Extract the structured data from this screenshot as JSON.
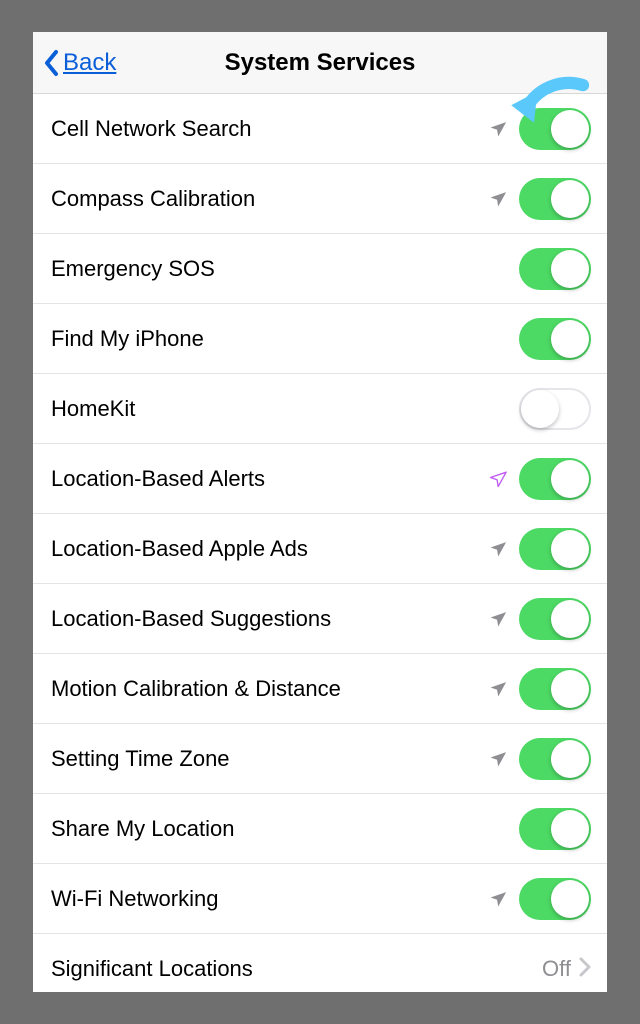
{
  "nav": {
    "back": "Back",
    "title": "System Services"
  },
  "colors": {
    "tint": "#007aff",
    "toggle_on": "#4cd964",
    "arrow_gray": "#8e8e93",
    "arrow_purple": "#bf5af2",
    "annotation": "#5ac8fa"
  },
  "rows": [
    {
      "label": "Cell Network Search",
      "accessory": "toggle",
      "on": true,
      "arrow": "gray"
    },
    {
      "label": "Compass Calibration",
      "accessory": "toggle",
      "on": true,
      "arrow": "gray"
    },
    {
      "label": "Emergency SOS",
      "accessory": "toggle",
      "on": true,
      "arrow": null
    },
    {
      "label": "Find My iPhone",
      "accessory": "toggle",
      "on": true,
      "arrow": null
    },
    {
      "label": "HomeKit",
      "accessory": "toggle",
      "on": false,
      "arrow": null
    },
    {
      "label": "Location-Based Alerts",
      "accessory": "toggle",
      "on": true,
      "arrow": "purple"
    },
    {
      "label": "Location-Based Apple Ads",
      "accessory": "toggle",
      "on": true,
      "arrow": "gray"
    },
    {
      "label": "Location-Based Suggestions",
      "accessory": "toggle",
      "on": true,
      "arrow": "gray"
    },
    {
      "label": "Motion Calibration & Distance",
      "accessory": "toggle",
      "on": true,
      "arrow": "gray"
    },
    {
      "label": "Setting Time Zone",
      "accessory": "toggle",
      "on": true,
      "arrow": "gray"
    },
    {
      "label": "Share My Location",
      "accessory": "toggle",
      "on": true,
      "arrow": null
    },
    {
      "label": "Wi-Fi Networking",
      "accessory": "toggle",
      "on": true,
      "arrow": "gray"
    },
    {
      "label": "Significant Locations",
      "accessory": "disclosure",
      "detail": "Off"
    }
  ]
}
